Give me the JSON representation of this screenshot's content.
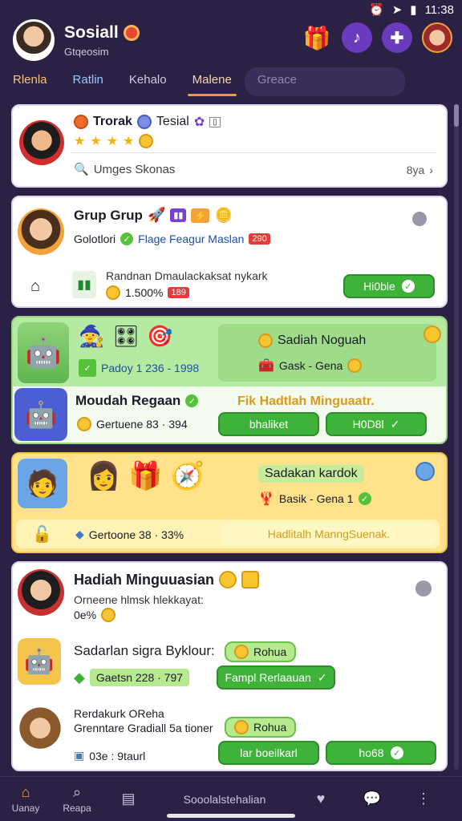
{
  "status": {
    "time": "11:38"
  },
  "header": {
    "title": "Sosiall",
    "subtitle": "Gtqeosim"
  },
  "tabs": [
    "Rlenla",
    "Ratlin",
    "Kehalo",
    "Malene",
    "Greace"
  ],
  "cards": {
    "c1": {
      "name": "Trorak",
      "tag": "Tesial",
      "search_text": "Umges Skonas",
      "page": "8ya"
    },
    "c2": {
      "name": "Grup Grup",
      "line1_a": "Golotlori",
      "line1_b": "Flage Feagur Maslan",
      "line1_badge": "290",
      "line2_title": "Randnan Dmaulackaksat nykark",
      "line2_value": "1.500%",
      "line2_badge": "189",
      "button": "Hi0ble"
    },
    "c3": {
      "line1": "Padoy 1 236 - 1998",
      "promo_title": "Sadiah Noguah",
      "promo_sub": "Gask - Gena",
      "item_name": "Moudah Regaan",
      "item_stat": "Gertuene 83 · 394",
      "banner": "Fik Hadtlah Minguaatr.",
      "btn1": "bhaliket",
      "btn2": "H0D8l"
    },
    "c4": {
      "promo_title": "Sadakan kardok",
      "promo_sub": "Basik - Gena 1",
      "stat": "Gertoone 38 · 33%",
      "banner": "Hadlitalh ManngSuenak."
    },
    "c5": {
      "title": "Hadiah Minguuasian",
      "desc1": "Orneene hlmsk hlekkayat:",
      "desc2": "0e%",
      "r1_title": "Sadarlan sigra Byklour:",
      "r1_badge": "Rohua",
      "r1_stat": "Gaetsn 228 · 797",
      "r1_btn": "Fampl Rerlaauan",
      "r2_title": "Rerdakurk OReha",
      "r2_sub": "Grenntare Gradiall 5a tioner",
      "r2_badge": "Rohua",
      "r2_foot": "03e : 9taurl",
      "r2_btn1": "lar boeilkarl",
      "r2_btn2": "ho68"
    }
  },
  "nav": {
    "home": "Uanay",
    "search": "Reapa",
    "center": "Sooolalstehalian"
  },
  "colors": {
    "bg": "#2a2144",
    "accent": "#f19a3e",
    "green": "#3fb23a",
    "card_green": "#b5eaa3",
    "card_yellow": "#ffe28a"
  }
}
